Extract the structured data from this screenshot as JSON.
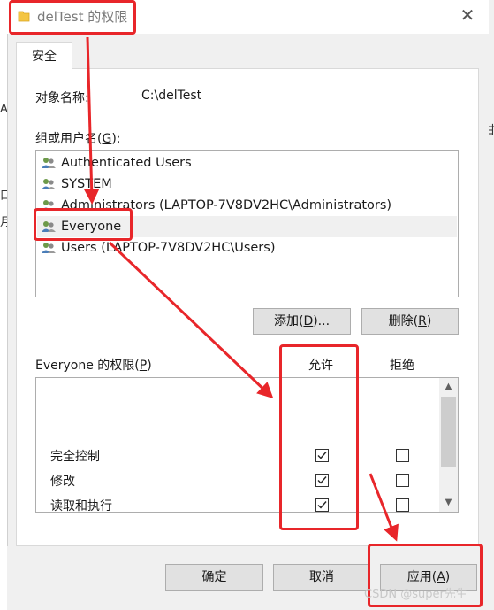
{
  "window": {
    "title": "delTest 的权限",
    "close_glyph": "✕"
  },
  "tab": {
    "label": "安全"
  },
  "object": {
    "label": "对象名称:",
    "value": "C:\\delTest"
  },
  "groups": {
    "label_prefix": "组或用户名(",
    "label_key": "G",
    "label_suffix": "):",
    "items": [
      {
        "name": "Authenticated Users",
        "selected": false
      },
      {
        "name": "SYSTEM",
        "selected": false
      },
      {
        "name": "Administrators (LAPTOP-7V8DV2HC\\Administrators)",
        "selected": false
      },
      {
        "name": "Everyone",
        "selected": true
      },
      {
        "name": "Users (LAPTOP-7V8DV2HC\\Users)",
        "selected": false
      }
    ]
  },
  "buttons": {
    "add_prefix": "添加(",
    "add_key": "D",
    "add_suffix": ")...",
    "remove_prefix": "删除(",
    "remove_key": "R",
    "remove_suffix": ")",
    "ok": "确定",
    "cancel": "取消",
    "apply_prefix": "应用(",
    "apply_key": "A",
    "apply_suffix": ")"
  },
  "permissions": {
    "label_prefix": "Everyone 的权限(",
    "label_key": "P",
    "label_suffix": ")",
    "allow_header": "允许",
    "deny_header": "拒绝",
    "rows": [
      {
        "name": "完全控制",
        "allow": true,
        "deny": false
      },
      {
        "name": "修改",
        "allow": true,
        "deny": false
      },
      {
        "name": "读取和执行",
        "allow": true,
        "deny": false
      }
    ]
  },
  "background_fragments": [
    "A)",
    "口",
    "月",
    "甘"
  ],
  "watermark": "CSDN @super先生",
  "colors": {
    "annotation_red": "#e8262a",
    "folder_yellow": "#f4c542",
    "selected_row": "#f0f0f0"
  }
}
